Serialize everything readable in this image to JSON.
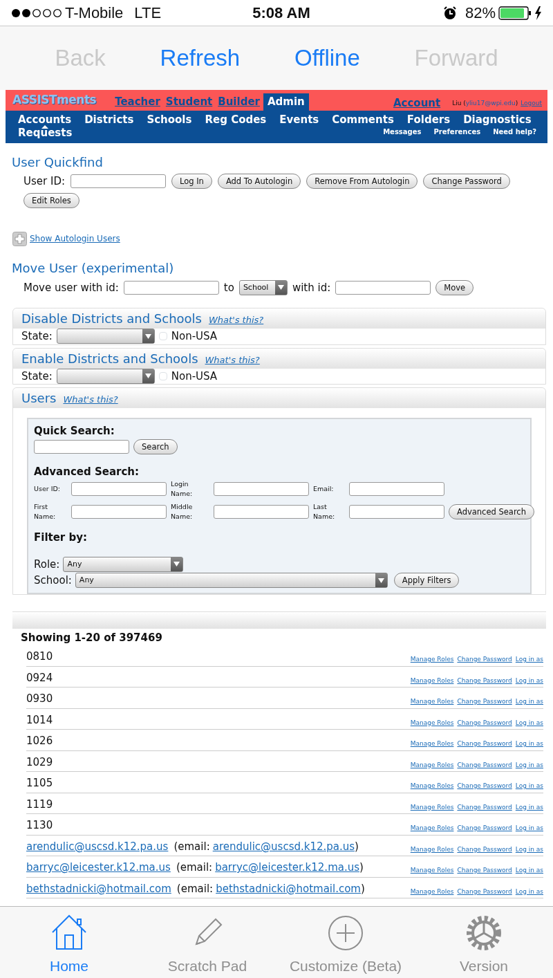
{
  "status_bar": {
    "carrier": "T-Mobile",
    "network": "LTE",
    "time": "5:08 AM",
    "battery": "82%"
  },
  "browser_toolbar": [
    {
      "label": "Back",
      "disabled": true
    },
    {
      "label": "Refresh",
      "disabled": false
    },
    {
      "label": "Offline",
      "disabled": false
    },
    {
      "label": "Forward",
      "disabled": true
    }
  ],
  "header": {
    "logo": "ASSISTments",
    "role_tabs": [
      {
        "label": "Teacher",
        "selected": false
      },
      {
        "label": "Student",
        "selected": false
      },
      {
        "label": "Builder",
        "selected": false
      },
      {
        "label": "Admin",
        "selected": true
      }
    ],
    "account": "Account",
    "user_name": "Liu (",
    "user_email": "yliu17@wpi.edu",
    "user_email_end": ")",
    "logout": "Logout"
  },
  "nav": {
    "items": [
      {
        "label": "Accounts",
        "selected": true
      },
      {
        "label": "Districts",
        "selected": false
      },
      {
        "label": "Schools",
        "selected": false
      },
      {
        "label": "Reg Codes",
        "selected": false
      },
      {
        "label": "Events",
        "selected": false
      },
      {
        "label": "Comments",
        "selected": false
      },
      {
        "label": "Folders",
        "selected": false
      },
      {
        "label": "Diagnostics",
        "selected": false
      }
    ],
    "sub_item": "Requests",
    "utility_links": [
      "Messages",
      "Preferences",
      "Need help?"
    ]
  },
  "user_quickfind": {
    "title": "User Quickfind",
    "label": "User ID:",
    "buttons": [
      "Log In",
      "Add To Autologin",
      "Remove From Autologin",
      "Change Password",
      "Edit Roles"
    ]
  },
  "show_autologin": "Show Autologin Users",
  "move_user": {
    "title": "Move User (experimental)",
    "label": "Move user with id:",
    "to": "to",
    "target": "School",
    "with_id": "with id:",
    "button": "Move"
  },
  "panels": [
    {
      "title": "Disable Districts and Schools",
      "help": "What's this?",
      "state_label": "State:",
      "non_usa": {
        "label": "Non-USA",
        "checked": false
      }
    },
    {
      "title": "Enable Districts and Schools",
      "help": "What's this?",
      "state_label": "State:",
      "non_usa": {
        "label": "Non-USA",
        "checked": false
      }
    }
  ],
  "users": {
    "title": "Users",
    "help": "What's this?",
    "quick_search": {
      "title": "Quick Search:",
      "button": "Search"
    },
    "advanced_search": {
      "title": "Advanced Search:",
      "fields": [
        "User ID:",
        "Login Name:",
        "Email:",
        "First Name:",
        "Middle Name:",
        "Last Name:"
      ],
      "button": "Advanced Search"
    },
    "filter": {
      "title": "Filter by:",
      "role_label": "Role:",
      "role": "Any",
      "school_label": "School:",
      "school": "Any",
      "button": "Apply Filters"
    },
    "showing": "Showing 1-20 of 397469",
    "rows": [
      {
        "kind": "id",
        "login": "0810",
        "actions": [
          "Manage Roles",
          "Change Password",
          "Log in as"
        ]
      },
      {
        "kind": "id",
        "login": "0924",
        "actions": [
          "Manage Roles",
          "Change Password",
          "Log in as"
        ]
      },
      {
        "kind": "id",
        "login": "0930",
        "actions": [
          "Manage Roles",
          "Change Password",
          "Log in as"
        ]
      },
      {
        "kind": "id",
        "login": "1014",
        "actions": [
          "Manage Roles",
          "Change Password",
          "Log in as"
        ]
      },
      {
        "kind": "id",
        "login": "1026",
        "actions": [
          "Manage Roles",
          "Change Password",
          "Log in as"
        ]
      },
      {
        "kind": "id",
        "login": "1029",
        "actions": [
          "Manage Roles",
          "Change Password",
          "Log in as"
        ]
      },
      {
        "kind": "id",
        "login": "1105",
        "actions": [
          "Manage Roles",
          "Change Password",
          "Log in as"
        ]
      },
      {
        "kind": "id",
        "login": "1119",
        "actions": [
          "Manage Roles",
          "Change Password",
          "Log in as"
        ]
      },
      {
        "kind": "id",
        "login": "1130",
        "actions": [
          "Manage Roles",
          "Change Password",
          "Log in as"
        ]
      },
      {
        "kind": "email",
        "login": "arendulic@uscsd.k12.pa.us",
        "email_prefix": "(email:",
        "email": "arendulic@uscsd.k12.pa.us",
        "email_suffix": ")",
        "actions": [
          "Manage Roles",
          "Change Password",
          "Log in as"
        ]
      },
      {
        "kind": "email",
        "login": "barryc@leicester.k12.ma.us",
        "email_prefix": "(email:",
        "email": "barryc@leicester.k12.ma.us",
        "email_suffix": ")",
        "actions": [
          "Manage Roles",
          "Change Password",
          "Log in as"
        ]
      },
      {
        "kind": "email",
        "login": "bethstadnicki@hotmail.com",
        "email_prefix": "(email:",
        "email": "bethstadnicki@hotmail.com",
        "email_suffix": ")",
        "actions": [
          "Manage Roles",
          "Change Password",
          "Log in as"
        ]
      }
    ]
  },
  "tab_bar": [
    {
      "label": "Home",
      "selected": true
    },
    {
      "label": "Scratch Pad",
      "selected": false
    },
    {
      "label": "Customize (Beta)",
      "selected": false
    },
    {
      "label": "Version",
      "selected": false
    }
  ]
}
